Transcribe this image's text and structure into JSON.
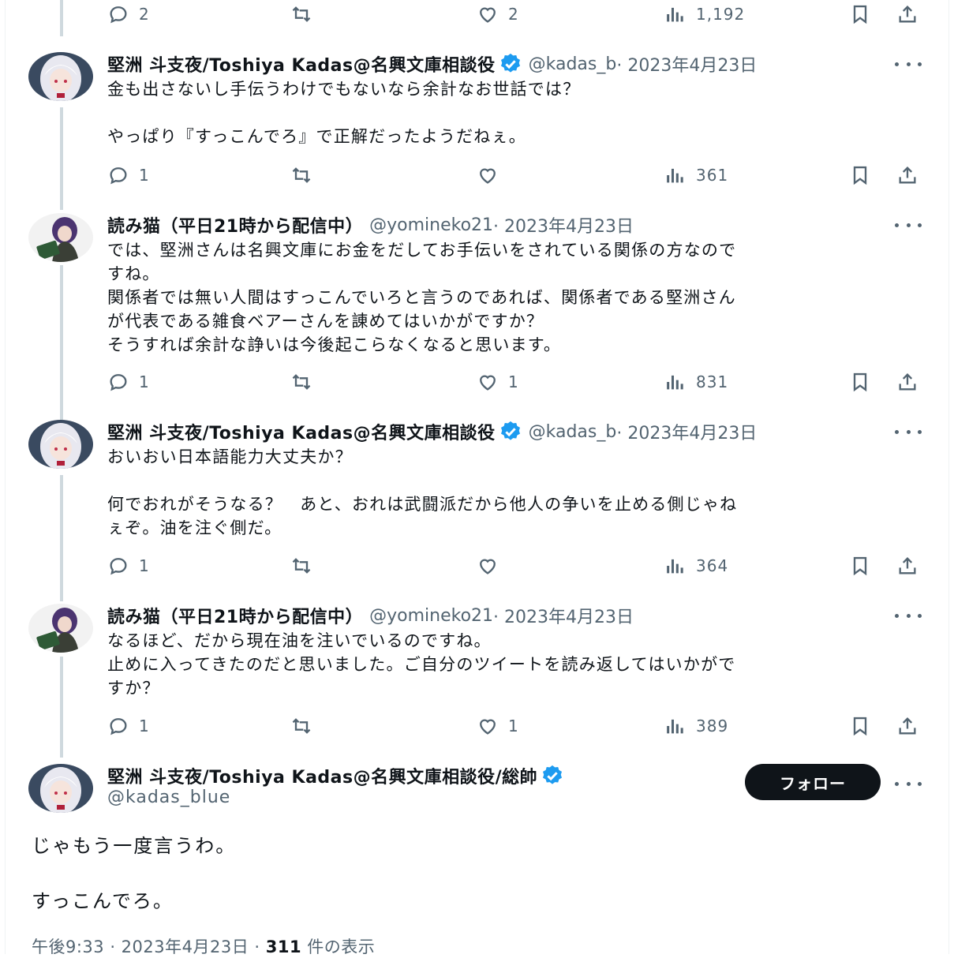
{
  "top_actions": {
    "replies": "2",
    "likes": "2",
    "views": "1,192"
  },
  "tweets": [
    {
      "name": "堅洲 斗支夜/Toshiya Kadas@名興文庫相談役",
      "handle": "@kadas_b",
      "date": " · 2023年4月23日",
      "text": "金も出さないし手伝うわけでもないなら余計なお世話では？\n\nやっぱり『すっこんでろ』で正解だったようだねぇ。",
      "replies": "1",
      "reposts": "",
      "likes": "",
      "views": "361"
    },
    {
      "name": "読み猫（平日21時から配信中）",
      "handle": "@yomineko21",
      "date": " · 2023年4月23日",
      "text": "では、堅洲さんは名興文庫にお金をだしてお手伝いをされている関係の方なので\nすね。\n関係者では無い人間はすっこんでいろと言うのであれば、関係者である堅洲さん\nが代表である雑食ベアーさんを諌めてはいかがですか？\nそうすれば余計な諍いは今後起こらなくなると思います。",
      "replies": "1",
      "reposts": "",
      "likes": "1",
      "views": "831"
    },
    {
      "name": "堅洲 斗支夜/Toshiya Kadas@名興文庫相談役",
      "handle": "@kadas_b",
      "date": " · 2023年4月23日",
      "text": "おいおい日本語能力大丈夫か？\n\n何でおれがそうなる？　あと、おれは武闘派だから他人の争いを止める側じゃね\nぇぞ。油を注ぐ側だ。",
      "replies": "1",
      "reposts": "",
      "likes": "",
      "views": "364"
    },
    {
      "name": "読み猫（平日21時から配信中）",
      "handle": "@yomineko21",
      "date": " · 2023年4月23日",
      "text": "なるほど、だから現在油を注いでいるのですね。\n止めに入ってきたのだと思いました。ご自分のツイートを読み返してはいかがで\nすか？",
      "replies": "1",
      "reposts": "",
      "likes": "1",
      "views": "389"
    }
  ],
  "main_tweet": {
    "name": "堅洲 斗支夜/Toshiya Kadas@名興文庫相談役/総帥",
    "handle": "@kadas_blue",
    "follow_label": "フォロー",
    "line1": "じゃもう一度言うわ。",
    "line2": "すっこんでろ。",
    "time": "午後9:33 · 2023年4月23日 · ",
    "views_count": "311",
    "views_suffix": " 件の表示"
  },
  "colors": {
    "text": "#0f1419",
    "muted": "#536471",
    "verified": "#1d9bf0",
    "thread_line": "#cfd9de",
    "follow_bg": "#0f1419"
  },
  "icons": [
    "reply-icon",
    "repost-icon",
    "like-icon",
    "views-icon",
    "bookmark-icon",
    "share-icon",
    "verified-badge-icon",
    "more-icon"
  ]
}
